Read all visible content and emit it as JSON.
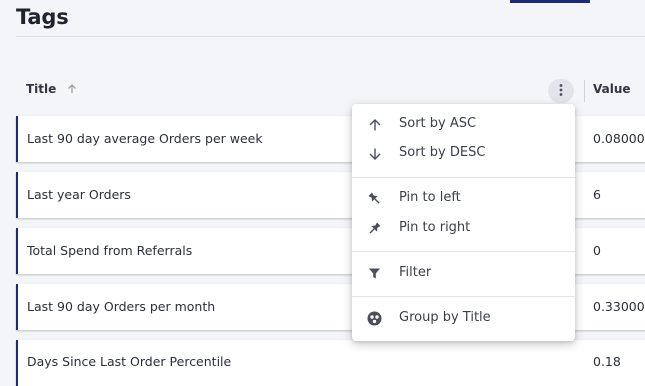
{
  "page": {
    "title": "Tags"
  },
  "grid": {
    "columns": {
      "title": "Title",
      "value": "Value"
    },
    "rows": [
      {
        "title": "Last 90 day average Orders per week",
        "value": "0.08000"
      },
      {
        "title": "Last year Orders",
        "value": "6"
      },
      {
        "title": "Total Spend from Referrals",
        "value": "0"
      },
      {
        "title": "Last 90 day Orders per month",
        "value": "0.33000"
      },
      {
        "title": "Days Since Last Order Percentile",
        "value": "0.18"
      }
    ]
  },
  "column_menu": {
    "items": [
      {
        "label": "Sort by ASC",
        "icon": "arrow-up-icon"
      },
      {
        "label": "Sort by DESC",
        "icon": "arrow-down-icon"
      },
      {
        "label": "Pin to left",
        "icon": "pin-left-icon"
      },
      {
        "label": "Pin to right",
        "icon": "pin-right-icon"
      },
      {
        "label": "Filter",
        "icon": "filter-icon"
      },
      {
        "label": "Group by Title",
        "icon": "group-icon"
      }
    ]
  },
  "colors": {
    "accent": "#1e2a78",
    "background": "#f4f5f8",
    "menu_bg": "#ffffff"
  }
}
